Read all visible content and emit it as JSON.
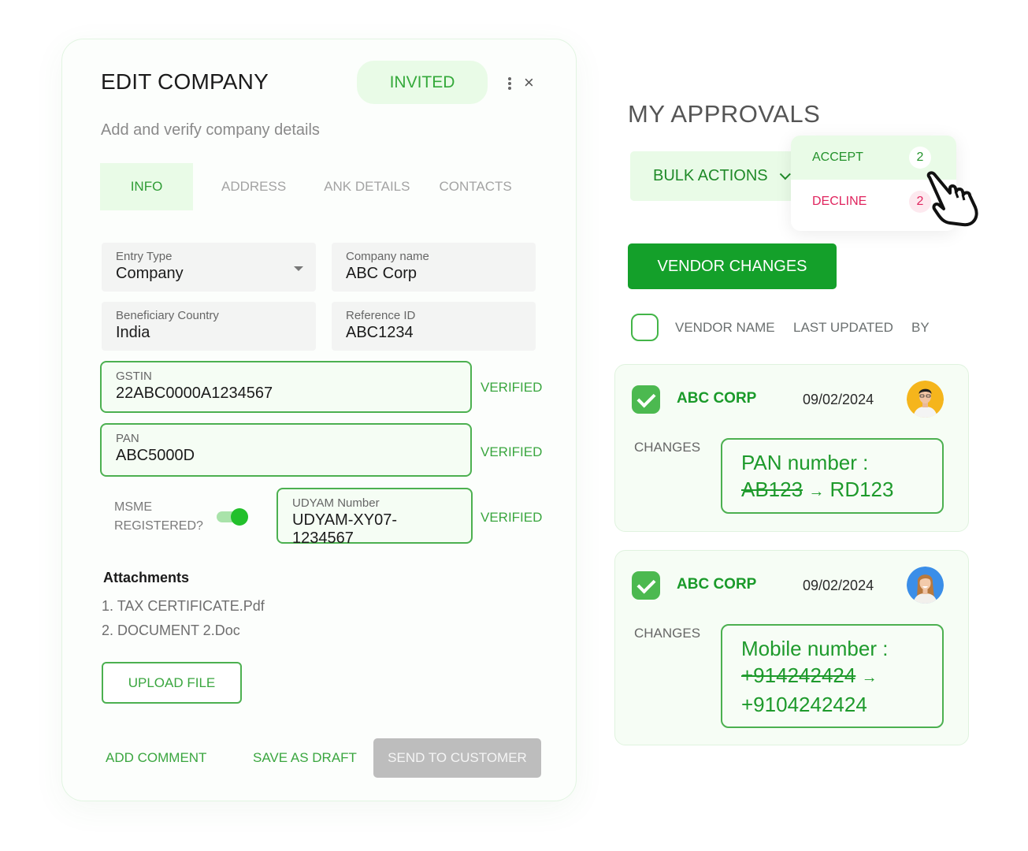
{
  "edit_company": {
    "title": "EDIT COMPANY",
    "status_badge": "INVITED",
    "subtitle": "Add and verify company details",
    "tabs": [
      {
        "label": "INFO",
        "active": true
      },
      {
        "label": "ADDRESS",
        "active": false
      },
      {
        "label": "ANK DETAILS",
        "active": false
      },
      {
        "label": "CONTACTS",
        "active": false
      }
    ],
    "fields": {
      "entry_type": {
        "label": "Entry Type",
        "value": "Company"
      },
      "company_name": {
        "label": "Company name",
        "value": "ABC Corp"
      },
      "beneficiary_country": {
        "label": "Beneficiary Country",
        "value": "India"
      },
      "reference_id": {
        "label": "Reference ID",
        "value": "ABC1234"
      },
      "gstin": {
        "label": "GSTIN",
        "value": "22ABC0000A1234567",
        "status": "VERIFIED"
      },
      "pan": {
        "label": "PAN",
        "value": "ABC5000D",
        "status": "VERIFIED"
      },
      "udyam": {
        "label": "UDYAM Number",
        "value": "UDYAM-XY07-1234567",
        "status": "VERIFIED"
      }
    },
    "msme": {
      "label_line1": "MSME",
      "label_line2": "REGISTERED?",
      "enabled": true
    },
    "attachments": {
      "title": "Attachments",
      "items": [
        "1. TAX CERTIFICATE.Pdf",
        "2. DOCUMENT 2.Doc"
      ],
      "upload_label": "UPLOAD FILE"
    },
    "footer": {
      "add_comment": "ADD COMMENT",
      "save_draft": "SAVE AS DRAFT",
      "send_to_customer": "SEND TO CUSTOMER"
    }
  },
  "approvals": {
    "title": "MY APPROVALS",
    "bulk_actions_label": "BULK ACTIONS",
    "bulk_menu": [
      {
        "label": "ACCEPT",
        "count": "2"
      },
      {
        "label": "DECLINE",
        "count": "2"
      }
    ],
    "vendor_changes_label": "VENDOR CHANGES",
    "columns": [
      "VENDOR NAME",
      "LAST UPDATED",
      "BY"
    ],
    "rows": [
      {
        "vendor": "ABC CORP",
        "date": "09/02/2024",
        "changes_label": "CHANGES",
        "change_field": "PAN number :",
        "old_value": "AB123",
        "arrow": "→",
        "new_value": "RD123"
      },
      {
        "vendor": "ABC CORP",
        "date": "09/02/2024",
        "changes_label": "CHANGES",
        "change_field": "Mobile number :",
        "old_value": "+914242424",
        "arrow": "→",
        "new_value": "+9104242424"
      }
    ]
  },
  "colors": {
    "brand_green": "#14a02a",
    "light_green": "#e9fbe7",
    "decline_red": "#e0245e",
    "disabled_grey": "#bdbdbd"
  }
}
